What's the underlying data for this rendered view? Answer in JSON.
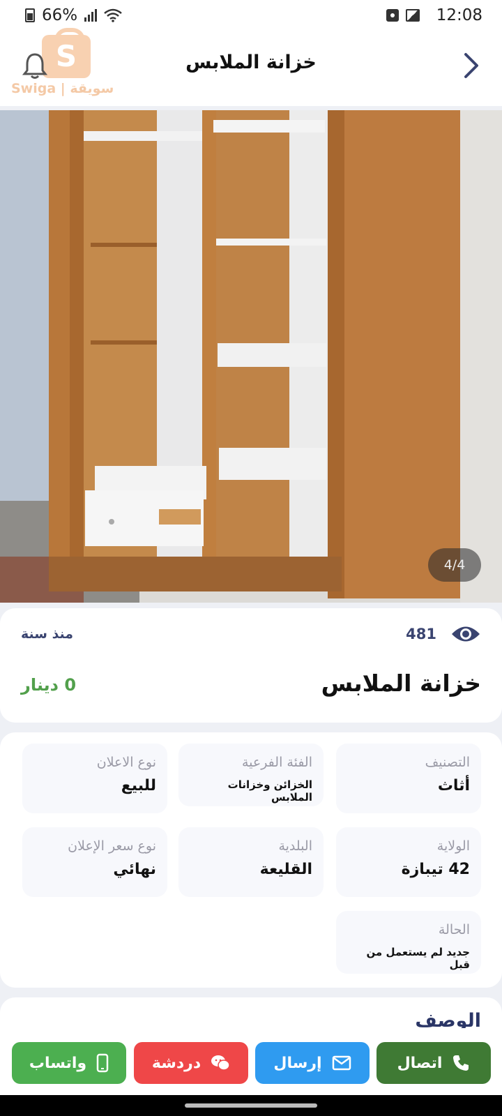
{
  "status_bar": {
    "battery": "66%",
    "time": "12:08"
  },
  "header": {
    "title": "خزانة الملابس",
    "logo_text": "Swiga | سويقة",
    "logo_letter": "S"
  },
  "photo": {
    "counter": "4/4"
  },
  "summary": {
    "views": "481",
    "posted": "منذ سنة",
    "title": "خزانة الملابس",
    "price": "0 دينار"
  },
  "details": [
    {
      "label": "التصنيف",
      "value": "أثاث"
    },
    {
      "label": "الفئة الفرعية",
      "value": "الخزائن وخزانات الملابس"
    },
    {
      "label": "نوع الاعلان",
      "value": "للبيع"
    },
    {
      "label": "الولاية",
      "value": "42 تيبازة"
    },
    {
      "label": "البلدية",
      "value": "القليعة"
    },
    {
      "label": "نوع سعر الإعلان",
      "value": "نهائي"
    },
    {
      "label": "الحالة",
      "value": "جديد لم يستعمل من قبل"
    }
  ],
  "description": {
    "title": "الوصف"
  },
  "actions": {
    "call": "اتصال",
    "send": "إرسال",
    "chat": "دردشة",
    "whatsapp": "واتساب"
  },
  "colors": {
    "call": "#3f7a34",
    "send": "#2f9bf0",
    "chat": "#ef4748",
    "whatsapp": "#4caf50",
    "price": "#52a04c"
  }
}
